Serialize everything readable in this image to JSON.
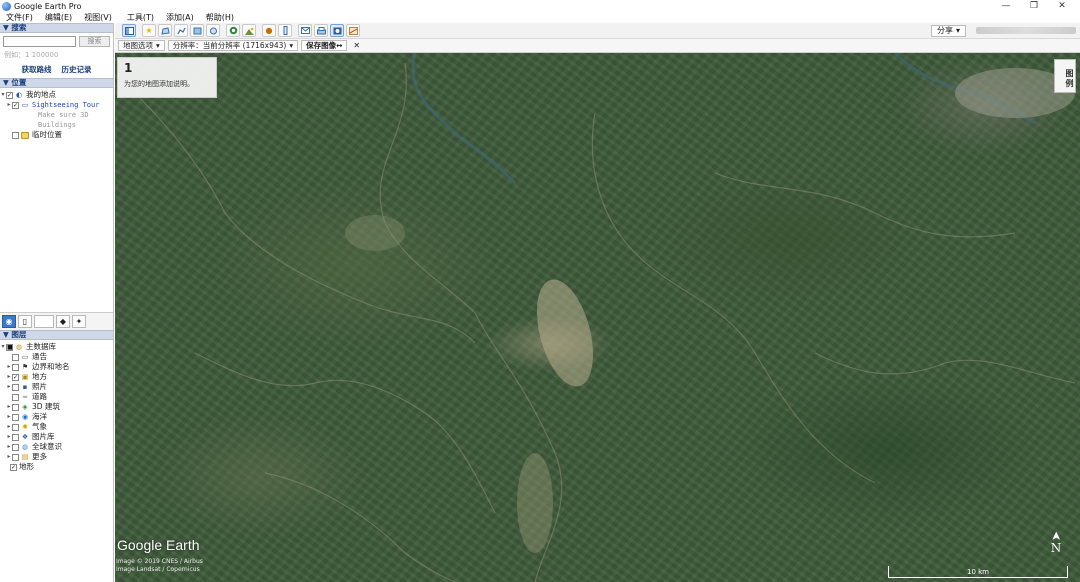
{
  "window": {
    "title": "Google Earth Pro",
    "min_symbol": "—",
    "max_symbol": "❐",
    "close_symbol": "✕"
  },
  "menu": {
    "items": [
      "文件(F)",
      "编辑(E)",
      "视图(V)",
      "工具(T)",
      "添加(A)",
      "帮助(H)"
    ]
  },
  "toolbar": {
    "share_label": "分享",
    "share_arrow": "▾",
    "icons": [
      "sidebar-toggle",
      "placemark",
      "polygon",
      "path",
      "image-overlay",
      "tour",
      "historical-imagery",
      "sunlight",
      "planets",
      "ruler",
      "email",
      "print",
      "save-image",
      "view-in-maps"
    ]
  },
  "imagebar": {
    "map_options": "地图选项",
    "resolution": "分辨率：当前分辨率 (1716x943)",
    "save_image": "保存图像↔",
    "close": "✕",
    "dropdown_arrow": "▾"
  },
  "search": {
    "header": "▼ 搜索",
    "placeholder": "",
    "button": "搜索",
    "hint": "例如：1 100000",
    "get_directions": "获取路线",
    "history": "历史记录"
  },
  "places": {
    "header": "▼ 位置",
    "my_places": "我的地点",
    "sightseeing": "Sightseeing Tour",
    "make_sure": "Make sure 3D",
    "buildings": "Buildings",
    "temp_places": "临时位置"
  },
  "layers": {
    "header": "▼ 图层",
    "primary_db": "主数据库",
    "items": [
      {
        "label": "通告",
        "arrow": "",
        "checked": false
      },
      {
        "label": "边界和地名",
        "arrow": "▸",
        "checked": false
      },
      {
        "label": "地方",
        "arrow": "▸",
        "checked": true
      },
      {
        "label": "照片",
        "arrow": "▸",
        "checked": false
      },
      {
        "label": "道路",
        "arrow": "",
        "checked": false
      },
      {
        "label": "3D 建筑",
        "arrow": "▸",
        "checked": false
      },
      {
        "label": "海洋",
        "arrow": "▸",
        "checked": false
      },
      {
        "label": "气象",
        "arrow": "▸",
        "checked": false
      },
      {
        "label": "图片库",
        "arrow": "▸",
        "checked": false
      },
      {
        "label": "全球意识",
        "arrow": "▸",
        "checked": false
      },
      {
        "label": "更多",
        "arrow": "▸",
        "checked": false
      }
    ],
    "terrain": "地形"
  },
  "map": {
    "legend_number": "1",
    "legend_text": "为您的地图添加说明。",
    "legend_button": "图例",
    "logo": "Google Earth",
    "credit1": "Image © 2019 CNES / Airbus",
    "credit2": "Image Landsat / Copernicus",
    "scale": "10 km",
    "compass_n": "N",
    "compass_needle": "➤"
  }
}
